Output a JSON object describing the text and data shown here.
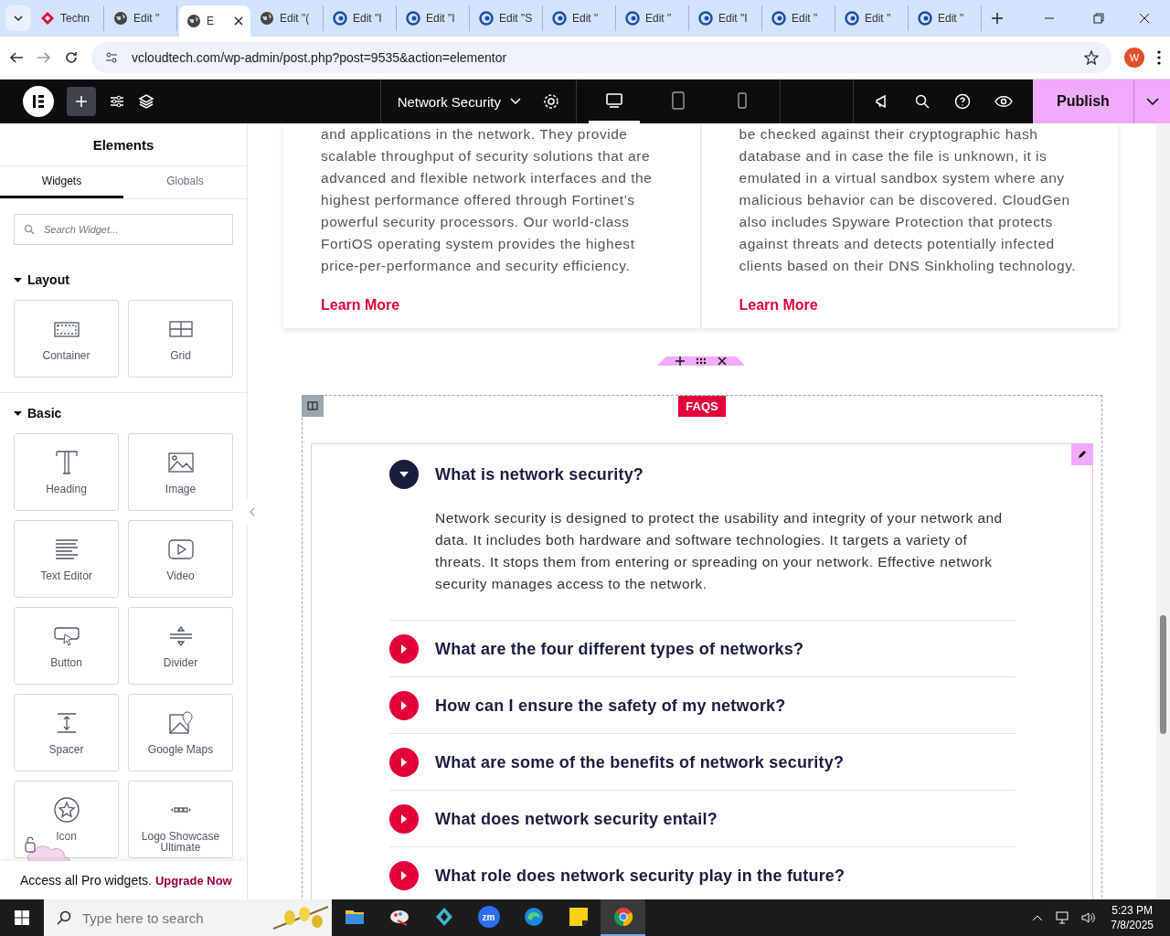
{
  "browser": {
    "tabs": [
      {
        "title": "Techn",
        "kind": "brand",
        "selected": false
      },
      {
        "title": "Edit \"",
        "kind": "globe",
        "selected": false
      },
      {
        "title": "E",
        "kind": "globe",
        "selected": true
      },
      {
        "title": "Edit \"(",
        "kind": "globe",
        "selected": false
      },
      {
        "title": "Edit \"I",
        "kind": "swirl",
        "selected": false
      },
      {
        "title": "Edit \"I",
        "kind": "swirl",
        "selected": false
      },
      {
        "title": "Edit \"S",
        "kind": "swirl",
        "selected": false
      },
      {
        "title": "Edit \"",
        "kind": "swirl",
        "selected": false
      },
      {
        "title": "Edit \"",
        "kind": "swirl",
        "selected": false
      },
      {
        "title": "Edit \"I",
        "kind": "swirl",
        "selected": false
      },
      {
        "title": "Edit \"",
        "kind": "swirl",
        "selected": false
      },
      {
        "title": "Edit \"",
        "kind": "swirl",
        "selected": false
      },
      {
        "title": "Edit \"",
        "kind": "swirl",
        "selected": false
      }
    ],
    "address": "vcloudtech.com/wp-admin/post.php?post=9535&action=elementor",
    "profile_initial": "W"
  },
  "editor_bar": {
    "page_title": "Network Security",
    "devices": [
      {
        "kind": "desktop",
        "selected": true
      },
      {
        "kind": "tablet",
        "selected": false
      },
      {
        "kind": "mobile",
        "selected": false
      }
    ],
    "publish": "Publish"
  },
  "panel": {
    "title": "Elements",
    "tabs": [
      {
        "label": "Widgets",
        "selected": true
      },
      {
        "label": "Globals",
        "selected": false
      }
    ],
    "search_placeholder": "Search Widget...",
    "categories": [
      {
        "name": "Layout",
        "expanded": true,
        "widgets": [
          {
            "label": "Container",
            "kind": "container"
          },
          {
            "label": "Grid",
            "kind": "grid"
          }
        ]
      },
      {
        "name": "Basic",
        "expanded": true,
        "widgets": [
          {
            "label": "Heading",
            "kind": "heading"
          },
          {
            "label": "Image",
            "kind": "image"
          },
          {
            "label": "Text Editor",
            "kind": "text"
          },
          {
            "label": "Video",
            "kind": "video"
          },
          {
            "label": "Button",
            "kind": "button"
          },
          {
            "label": "Divider",
            "kind": "divider"
          },
          {
            "label": "Spacer",
            "kind": "spacer"
          },
          {
            "label": "Google Maps",
            "kind": "map"
          },
          {
            "label": "Icon",
            "kind": "icon"
          },
          {
            "label": "Logo Showcase Ultimate",
            "kind": "logos"
          }
        ]
      }
    ],
    "promo": {
      "text": "Access all Pro widgets.",
      "link": "Upgrade Now"
    }
  },
  "canvas": {
    "cards": [
      {
        "text": "and applications in the network. They provide scalable throughput of security solutions that are advanced and flexible network interfaces and the highest performance offered through Fortinet’s powerful security processors. Our world-class FortiOS operating system provides the highest price-per-performance and security efficiency.",
        "link": "Learn More"
      },
      {
        "text": "be checked against their cryptographic hash database and in case the file is unknown, it is emulated in a virtual sandbox system where any malicious behavior can be discovered. CloudGen also includes Spyware Protection that protects against threats and detects potentially infected clients based on their DNS Sinkholing technology.",
        "link": "Learn More"
      }
    ],
    "section_tag": "FAQS",
    "faqs": [
      {
        "question": "What is network security?",
        "expanded": true,
        "answer": "Network security is designed to protect the usability and integrity of your network and data. It includes both hardware and software technologies. It targets a variety of threats. It stops them from entering or spreading on your network. Effective network security manages access to the network."
      },
      {
        "question": "What are the four different types of networks?",
        "expanded": false
      },
      {
        "question": "How can I ensure the safety of my network?",
        "expanded": false
      },
      {
        "question": "What are some of the benefits of network security?",
        "expanded": false
      },
      {
        "question": "What does network security entail?",
        "expanded": false
      },
      {
        "question": "What role does network security play in the future?",
        "expanded": false
      }
    ]
  },
  "taskbar": {
    "search_placeholder": "Type here to search",
    "apps": [
      {
        "kind": "folder",
        "selected": false
      },
      {
        "kind": "paint",
        "selected": false
      },
      {
        "kind": "diamond",
        "selected": false
      },
      {
        "kind": "zoom",
        "selected": false
      },
      {
        "kind": "edge",
        "selected": false
      },
      {
        "kind": "notes",
        "selected": false
      },
      {
        "kind": "chrome",
        "selected": true
      }
    ],
    "zoom_label": "zm",
    "time": "5:23 PM",
    "date": "7/8/2025"
  }
}
